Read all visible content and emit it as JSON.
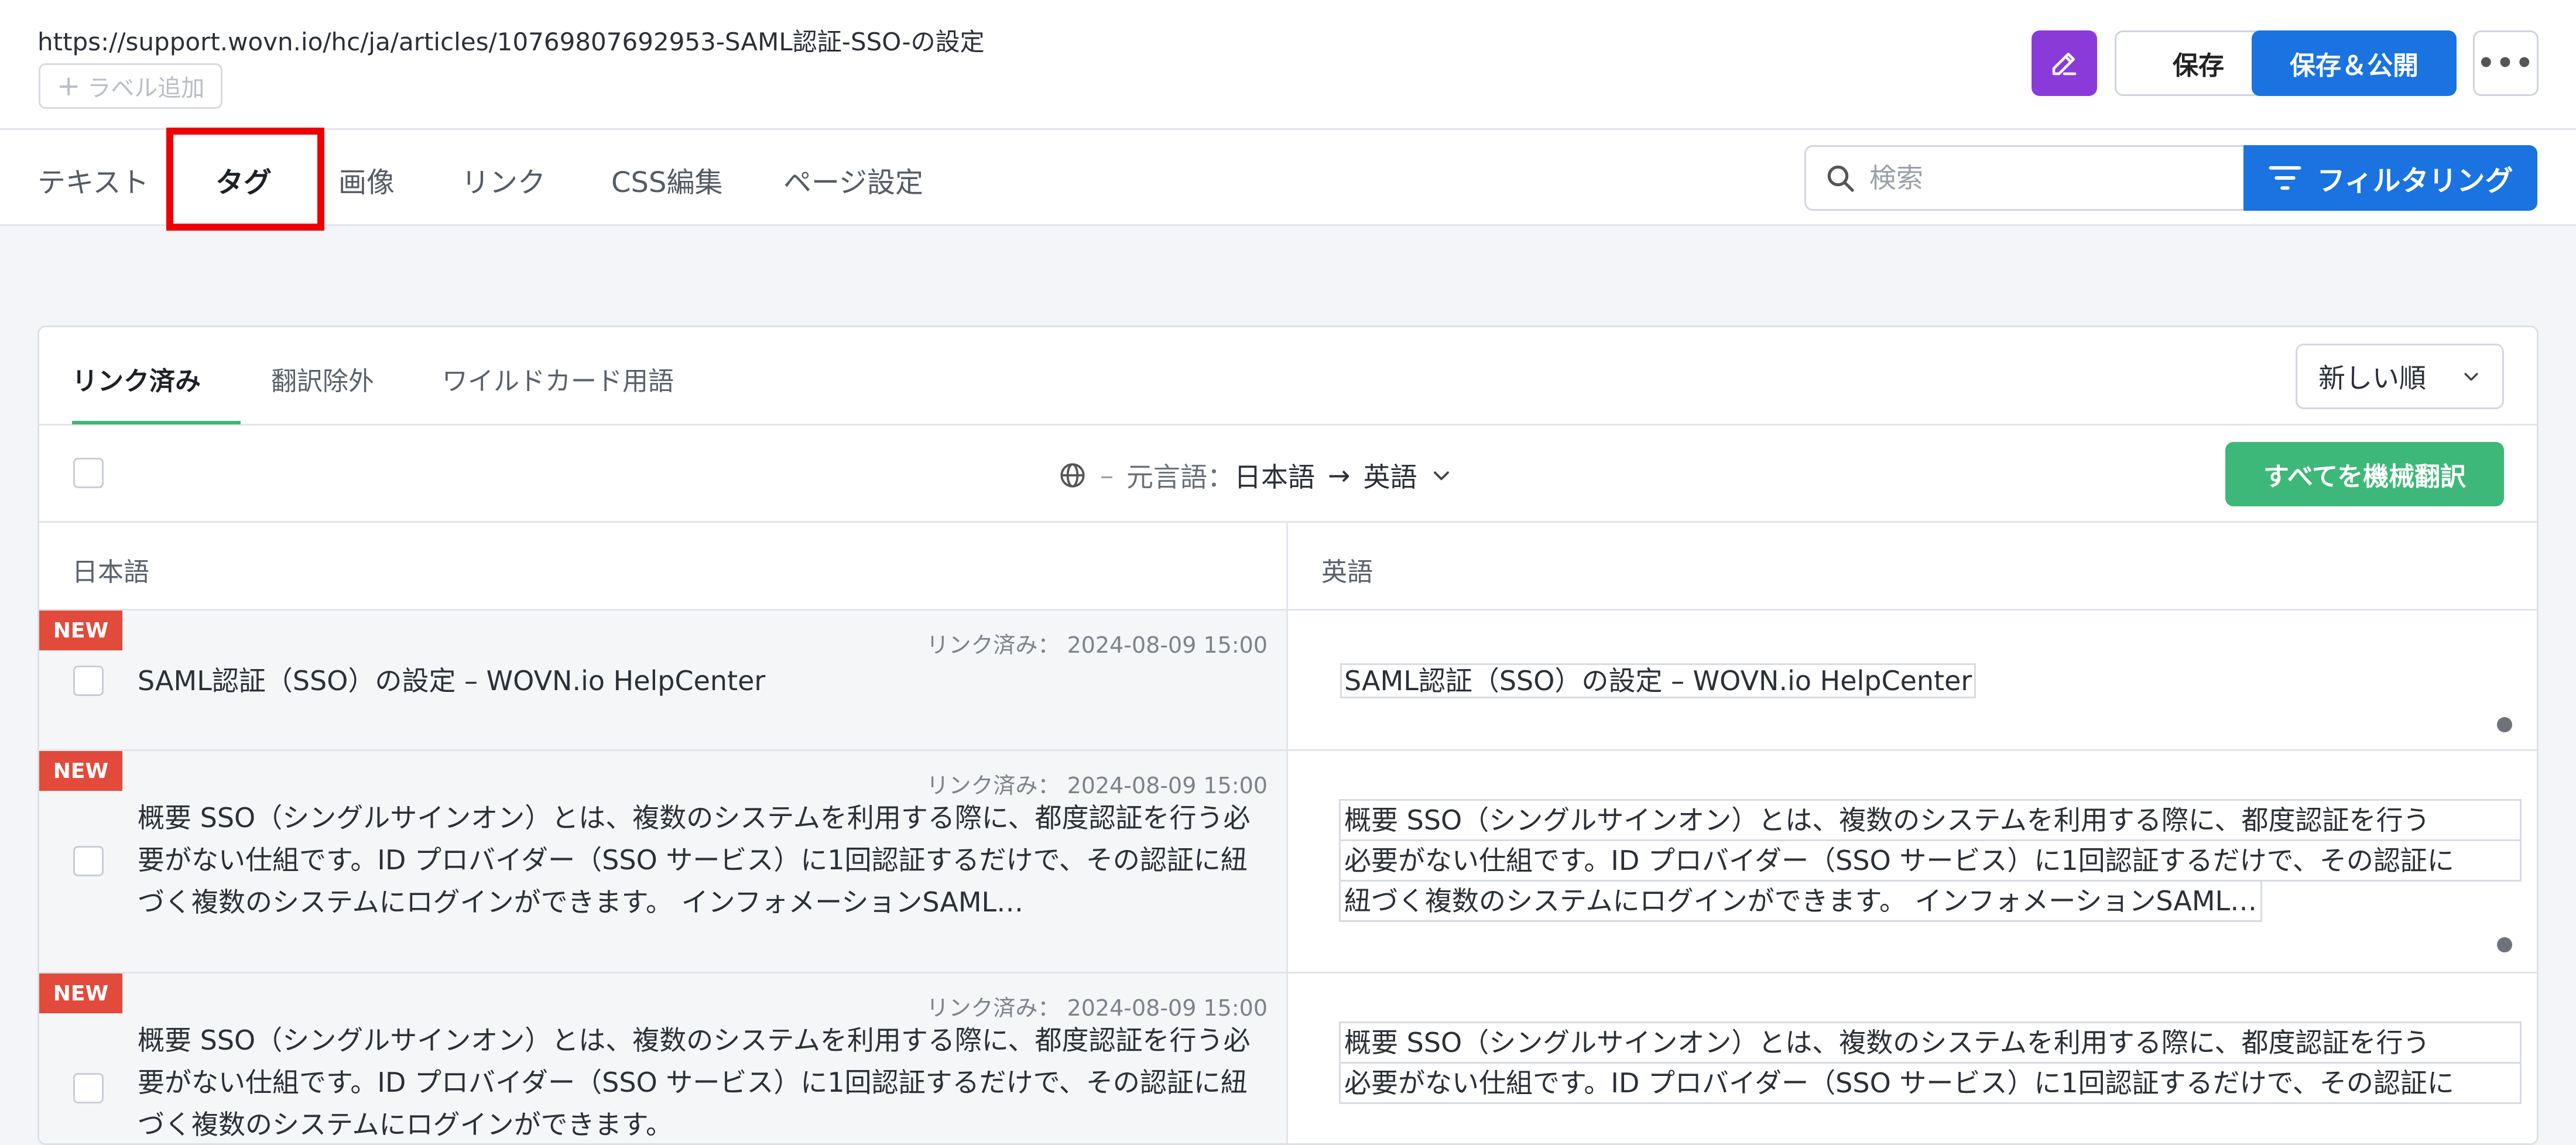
{
  "header": {
    "url": "https://support.wovn.io/hc/ja/articles/10769807692953-SAML認証-SSO-の設定",
    "label_add": "ラベル追加",
    "save_label": "保存",
    "publish_label": "保存＆公開",
    "more_label": "•••",
    "edit_color": "#8a3ad9"
  },
  "tabs": [
    {
      "label": "テキスト"
    },
    {
      "label": "タグ",
      "active": true
    },
    {
      "label": "画像"
    },
    {
      "label": "リンク"
    },
    {
      "label": "CSS編集"
    },
    {
      "label": "ページ設定"
    }
  ],
  "search": {
    "placeholder": "検索",
    "value": ""
  },
  "filter": {
    "label": "フィルタリング"
  },
  "subtabs": [
    {
      "label": "リンク済み",
      "active": true
    },
    {
      "label": "翻訳除外"
    },
    {
      "label": "ワイルドカード用語"
    }
  ],
  "sort": {
    "selected": "新しい順"
  },
  "language": {
    "dash": "–",
    "source_label": "元言語：",
    "source": "日本語",
    "arrow": "→",
    "target": "英語"
  },
  "machine_translate_label": "すべてを機械翻訳",
  "columns": {
    "source": "日本語",
    "target": "英語"
  },
  "rows": [
    {
      "badge": "NEW",
      "meta": "リンク済み： 2024-08-09 15:00",
      "source": "SAML認証（SSO）の設定 – WOVN.io HelpCenter",
      "target": "SAML認証（SSO）の設定 – WOVN.io HelpCenter"
    },
    {
      "badge": "NEW",
      "meta": "リンク済み： 2024-08-09 15:00",
      "source": "概要 SSO（シングルサインオン）とは、複数のシステムを利用する際に、都度認証を行う必要がない仕組です。ID プロバイダー（SSO サービス）に1回認証するだけで、その認証に紐づく複数のシステムにログインができます。 インフォメーションSAML…",
      "target_lines": [
        "概要 SSO（シングルサインオン）とは、複数のシステムを利用する際に、都度認証を行う",
        "必要がない仕組です。ID プロバイダー（SSO サービス）に1回認証するだけで、その認証に",
        "紐づく複数のシステムにログインができます。 インフォメーションSAML…"
      ]
    },
    {
      "badge": "NEW",
      "meta": "リンク済み： 2024-08-09 15:00",
      "source": "概要 SSO（シングルサインオン）とは、複数のシステムを利用する際に、都度認証を行う必要がない仕組です。ID プロバイダー（SSO サービス）に1回認証するだけで、その認証に紐づく複数のシステムにログインができます。",
      "target_lines": [
        "概要 SSO（シングルサインオン）とは、複数のシステムを利用する際に、都度認証を行う",
        "必要がない仕組です。ID プロバイダー（SSO サービス）に1回認証するだけで、その認証に"
      ]
    }
  ],
  "icons": {
    "edit": "pencil-icon",
    "search": "search-icon",
    "filter": "filter-icon",
    "globe": "globe-icon",
    "sort_chevron": "chevron-down-icon"
  },
  "colors": {
    "primary": "#1a73e0",
    "success": "#3db878",
    "new_badge": "#e24a3b",
    "highlight": "#ee0000"
  }
}
